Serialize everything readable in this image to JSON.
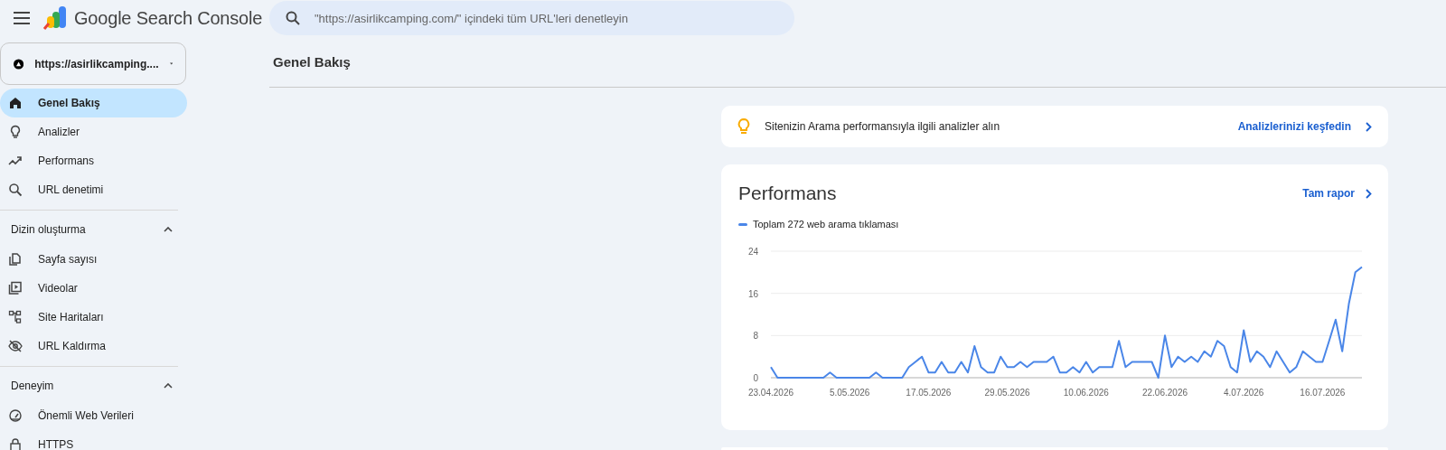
{
  "app": {
    "title": "Google Search Console"
  },
  "search": {
    "placeholder": "\"https://asirlikcamping.com/\" içindeki tüm URL'leri denetleyin"
  },
  "property": {
    "label": "https://asirlikcamping...."
  },
  "sidebar": {
    "items": [
      {
        "label": "Genel Bakış",
        "kind": "home",
        "selected": true
      },
      {
        "label": "Analizler",
        "kind": "bulb",
        "selected": false
      },
      {
        "label": "Performans",
        "kind": "trend",
        "selected": false
      },
      {
        "label": "URL denetimi",
        "kind": "search",
        "selected": false
      }
    ],
    "sections": [
      {
        "title": "Dizin oluşturma",
        "expanded": true,
        "items": [
          {
            "label": "Sayfa sayısı",
            "kind": "pages",
            "selected": false
          },
          {
            "label": "Videolar",
            "kind": "video",
            "selected": false
          },
          {
            "label": "Site Haritaları",
            "kind": "sitemap",
            "selected": false
          },
          {
            "label": "URL Kaldırma",
            "kind": "hidden",
            "selected": false
          }
        ]
      },
      {
        "title": "Deneyim",
        "expanded": true,
        "items": [
          {
            "label": "Önemli Web Verileri",
            "kind": "gauge",
            "selected": false
          },
          {
            "label": "HTTPS",
            "kind": "lock",
            "selected": false
          }
        ]
      }
    ]
  },
  "page": {
    "title": "Genel Bakış"
  },
  "insights": {
    "text": "Sitenizin Arama performansıyla ilgili analizler alın",
    "link": "Analizlerinizi keşfedin"
  },
  "performance": {
    "title": "Performans",
    "link": "Tam rapor",
    "chart_data": {
      "type": "line",
      "categories": [
        "23.04.2026",
        null,
        null,
        null,
        null,
        null,
        null,
        null,
        null,
        null,
        null,
        null,
        "5.05.2026",
        null,
        null,
        null,
        null,
        null,
        null,
        null,
        null,
        null,
        null,
        null,
        "17.05.2026",
        null,
        null,
        null,
        null,
        null,
        null,
        null,
        null,
        null,
        null,
        null,
        "29.05.2026",
        null,
        null,
        null,
        null,
        null,
        null,
        null,
        null,
        null,
        null,
        null,
        "10.06.2026",
        null,
        null,
        null,
        null,
        null,
        null,
        null,
        null,
        null,
        null,
        null,
        "22.06.2026",
        null,
        null,
        null,
        null,
        null,
        null,
        null,
        null,
        null,
        null,
        null,
        "4.07.2026",
        null,
        null,
        null,
        null,
        null,
        null,
        null,
        null,
        null,
        null,
        null,
        "16.07.2026",
        null,
        null,
        null,
        null,
        null,
        null
      ],
      "series": [
        {
          "name": "Toplam 272 web arama tıklaması",
          "color": "#4a86e8",
          "values": [
            2,
            0,
            0,
            0,
            0,
            0,
            0,
            0,
            0,
            1,
            0,
            0,
            0,
            0,
            0,
            0,
            1,
            0,
            0,
            0,
            0,
            2,
            3,
            4,
            1,
            1,
            3,
            1,
            1,
            3,
            1,
            6,
            2,
            1,
            1,
            4,
            2,
            2,
            3,
            2,
            3,
            3,
            3,
            4,
            1,
            1,
            2,
            1,
            3,
            1,
            2,
            2,
            2,
            7,
            2,
            3,
            3,
            3,
            3,
            0,
            8,
            2,
            4,
            3,
            4,
            3,
            5,
            4,
            7,
            6,
            2,
            1,
            9,
            3,
            5,
            4,
            2,
            5,
            3,
            1,
            2,
            5,
            4,
            3,
            3,
            7,
            11,
            5,
            14,
            20,
            21
          ]
        }
      ],
      "ylim": [
        0,
        24
      ],
      "yticks": [
        0,
        8,
        16,
        24
      ]
    }
  }
}
